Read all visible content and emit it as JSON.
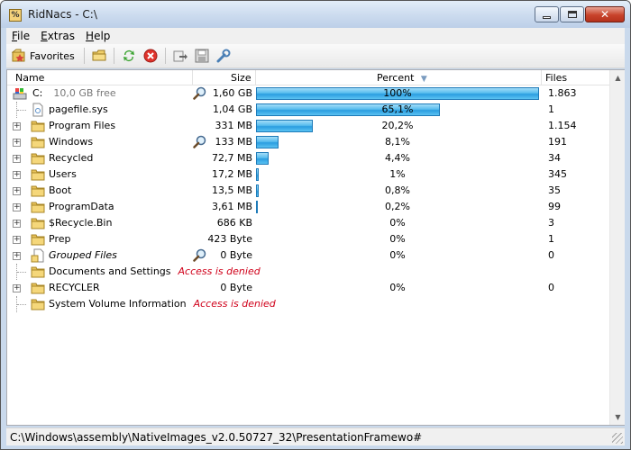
{
  "window": {
    "title": "RidNacs - C:\\",
    "app_icon_glyph": "%"
  },
  "menu": [
    {
      "label": "File",
      "underline": "F",
      "rest": "ile"
    },
    {
      "label": "Extras",
      "underline": "E",
      "rest": "xtras"
    },
    {
      "label": "Help",
      "underline": "H",
      "rest": "elp"
    }
  ],
  "toolbar": {
    "favorites_label": "Favorites",
    "icons": [
      "favorites-icon",
      "open-folder-icon",
      "refresh-icon",
      "stop-icon",
      "export-icon",
      "save-icon",
      "settings-wrench-icon"
    ]
  },
  "columns": {
    "name": "Name",
    "size": "Size",
    "percent": "Percent",
    "files": "Files",
    "sort_indicator": "▼"
  },
  "rows": [
    {
      "name": "C:",
      "free": "10,0 GB free",
      "size": "1,60 GB",
      "percent": "100%",
      "fraction": 1.0,
      "files": "1.863",
      "type": "drive",
      "expander": false,
      "search": true
    },
    {
      "name": "pagefile.sys",
      "size": "1,04 GB",
      "percent": "65,1%",
      "fraction": 0.651,
      "files": "1",
      "type": "file",
      "expander": false,
      "search": false
    },
    {
      "name": "Program Files",
      "size": "331 MB",
      "percent": "20,2%",
      "fraction": 0.202,
      "files": "1.154",
      "type": "folder",
      "expander": true,
      "search": false
    },
    {
      "name": "Windows",
      "size": "133 MB",
      "percent": "8,1%",
      "fraction": 0.081,
      "files": "191",
      "type": "folder",
      "expander": true,
      "search": true
    },
    {
      "name": "Recycled",
      "size": "72,7 MB",
      "percent": "4,4%",
      "fraction": 0.044,
      "files": "34",
      "type": "folder",
      "expander": true,
      "search": false
    },
    {
      "name": "Users",
      "size": "17,2 MB",
      "percent": "1%",
      "fraction": 0.01,
      "files": "345",
      "type": "folder",
      "expander": true,
      "search": false
    },
    {
      "name": "Boot",
      "size": "13,5 MB",
      "percent": "0,8%",
      "fraction": 0.008,
      "files": "35",
      "type": "folder",
      "expander": true,
      "search": false
    },
    {
      "name": "ProgramData",
      "size": "3,61 MB",
      "percent": "0,2%",
      "fraction": 0.002,
      "files": "99",
      "type": "folder",
      "expander": true,
      "search": false
    },
    {
      "name": "$Recycle.Bin",
      "size": "686 KB",
      "percent": "0%",
      "fraction": 0.0,
      "files": "3",
      "type": "folder",
      "expander": true,
      "search": false
    },
    {
      "name": "Prep",
      "size": "423 Byte",
      "percent": "0%",
      "fraction": 0.0,
      "files": "1",
      "type": "folder",
      "expander": true,
      "search": false
    },
    {
      "name": "Grouped Files",
      "size": "0 Byte",
      "percent": "0%",
      "fraction": 0.0,
      "files": "0",
      "type": "grouped",
      "expander": true,
      "search": true,
      "italic": true
    },
    {
      "name": "Documents and Settings",
      "error": "Access is denied",
      "size": "",
      "percent": "",
      "fraction": null,
      "files": "",
      "type": "folder",
      "expander": false,
      "search": false
    },
    {
      "name": "RECYCLER",
      "size": "0 Byte",
      "percent": "0%",
      "fraction": 0.0,
      "files": "0",
      "type": "folder",
      "expander": true,
      "search": false
    },
    {
      "name": "System Volume Information",
      "error": "Access is denied",
      "size": "",
      "percent": "",
      "fraction": null,
      "files": "",
      "type": "folder",
      "expander": false,
      "search": false
    }
  ],
  "status": {
    "path": "C:\\Windows\\assembly\\NativeImages_v2.0.50727_32\\PresentationFramewo#"
  }
}
